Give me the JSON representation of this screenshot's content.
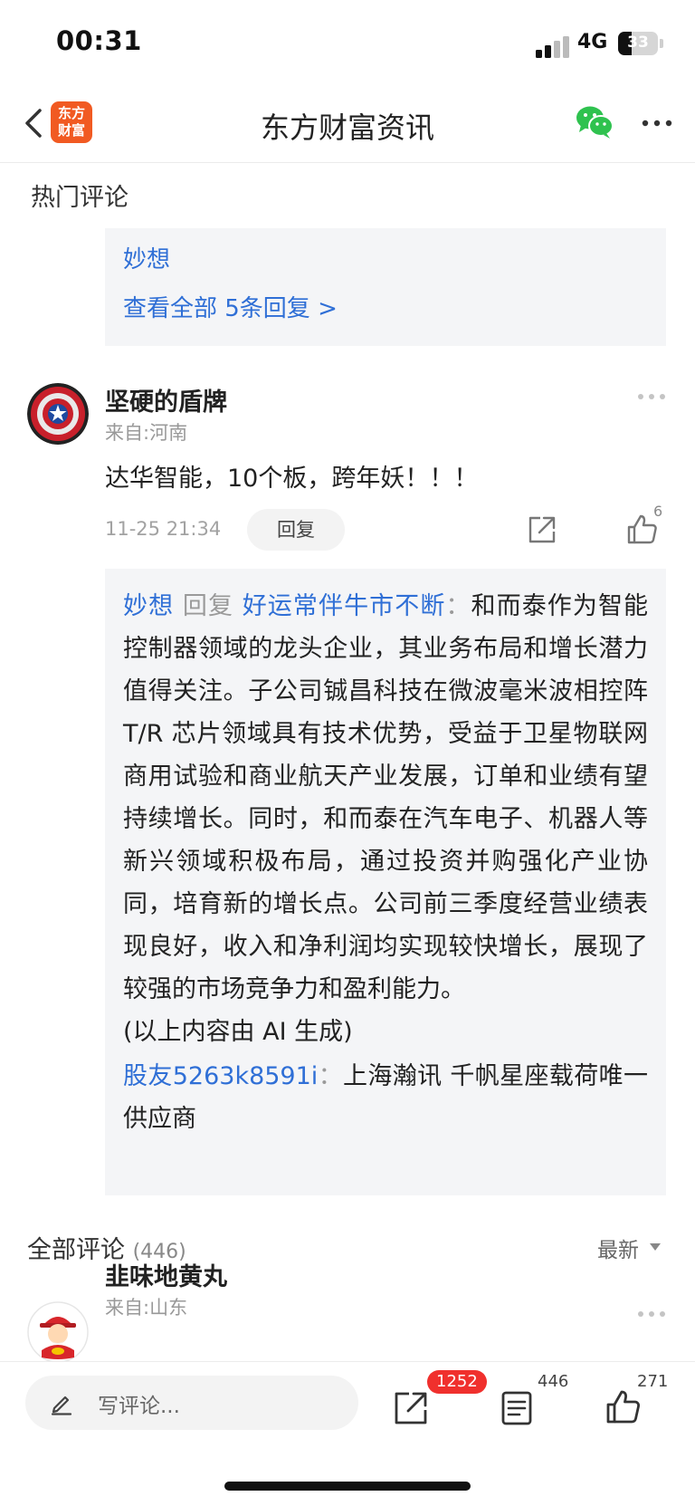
{
  "status_bar": {
    "time": "00:31",
    "network": "4G",
    "battery": "33",
    "battery_level": 0.33
  },
  "nav": {
    "title": "东方财富资讯",
    "logo_line1": "东方",
    "logo_line2": "财富",
    "back_icon": "chevron-left-icon",
    "share_icon": "wechat-icon",
    "more_icon": "more-dots-icon"
  },
  "hot_comments": {
    "title": "热门评论",
    "first_reply_box": {
      "name": "妙想",
      "view_all": "查看全部 5条回复 >"
    },
    "comment": {
      "username": "坚硬的盾牌",
      "location": "来自:河南",
      "text": "达华智能，10个板，跨年妖！！！",
      "time": "11-25 21:34",
      "reply_label": "回复",
      "likes": "6",
      "replies": {
        "author": "妙想",
        "reply_word": "回复",
        "target": "好运常伴牛市不断",
        "separator": "：",
        "body": "和而泰作为智能控制器领域的龙头企业，其业务布局和增长潜力值得关注。子公司铖昌科技在微波毫米波相控阵 T/R 芯片领域具有技术优势，受益于卫星物联网商用试验和商业航天产业发展，订单和业绩有望持续增长。同时，和而泰在汽车电子、机器人等新兴领域积极布局，通过投资并购强化产业协同，培育新的增长点。公司前三季度经营业绩表现良好，收入和净利润均实现较快增长，展现了较强的市场竞争力和盈利能力。",
        "ai_note": "(以上内容由 AI 生成)",
        "second_author": "股友5263k8591i",
        "second_separator": "：",
        "second_body": "上海瀚讯 千帆星座载荷唯一供应商"
      }
    }
  },
  "all_comments": {
    "title": "全部评论",
    "count": "(446)",
    "sort": "最新",
    "first": {
      "username": "韭味地黄丸",
      "location": "来自:山东"
    }
  },
  "bottom_bar": {
    "placeholder": "写评论...",
    "share_count": "1252",
    "comment_count": "446",
    "like_count": "271"
  }
}
